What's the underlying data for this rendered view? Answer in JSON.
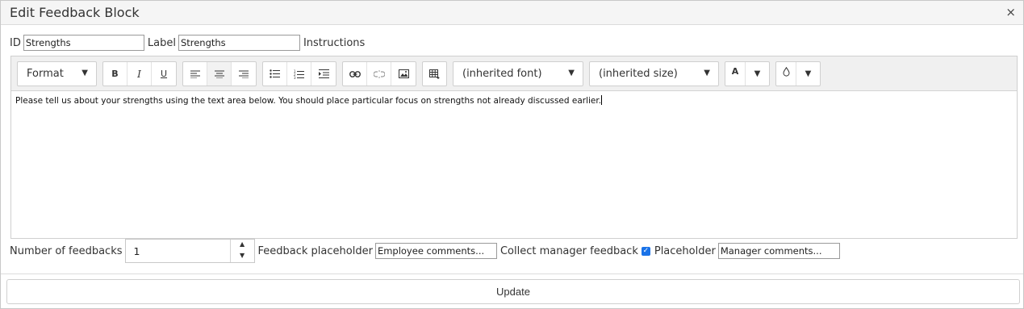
{
  "dialog": {
    "title": "Edit Feedback Block",
    "close_glyph": "×"
  },
  "fields": {
    "id_label": "ID",
    "id_value": "Strengths",
    "label_label": "Label",
    "label_value": "Strengths",
    "instructions_label": "Instructions"
  },
  "toolbar": {
    "format_label": "Format",
    "bold": "B",
    "italic": "I",
    "underline": "U",
    "font_label": "(inherited font)",
    "size_label": "(inherited size)",
    "text_color_glyph": "A",
    "caret": "▼"
  },
  "editor": {
    "content": "Please tell us about your strengths using the text area below. You should place particular focus on strengths not already discussed earlier."
  },
  "options": {
    "number_label": "Number of feedbacks",
    "number_value": "1",
    "up_glyph": "▲",
    "down_glyph": "▼",
    "feedback_placeholder_label": "Feedback placeholder",
    "feedback_placeholder_value": "Employee comments...",
    "collect_manager_label": "Collect manager feedback",
    "collect_manager_checked": true,
    "checkmark": "✓",
    "placeholder_label": "Placeholder",
    "manager_placeholder_value": "Manager comments..."
  },
  "footer": {
    "update_label": "Update"
  }
}
